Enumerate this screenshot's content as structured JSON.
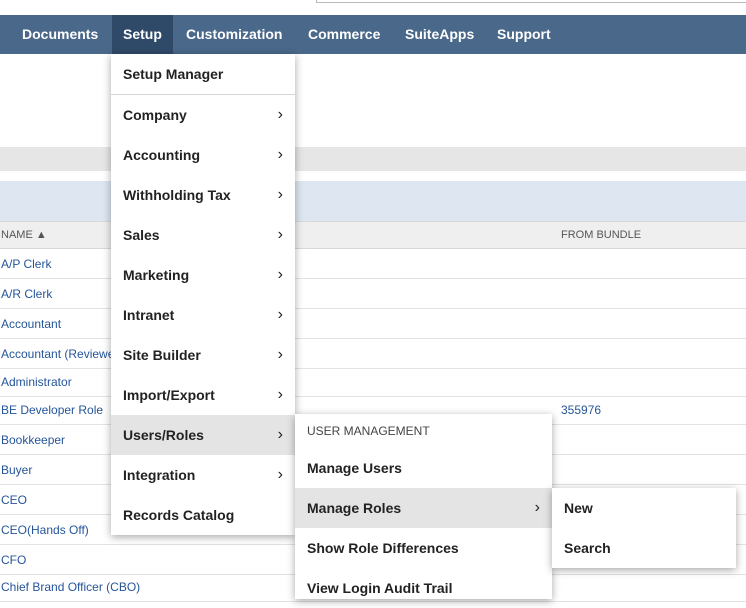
{
  "nav": {
    "items": [
      "Documents",
      "Setup",
      "Customization",
      "Commerce",
      "SuiteApps",
      "Support"
    ]
  },
  "table": {
    "col_name": "NAME ▲",
    "col_bundle": "FROM BUNDLE",
    "rows": [
      {
        "name": "A/P Clerk",
        "bundle": ""
      },
      {
        "name": "A/R Clerk",
        "bundle": ""
      },
      {
        "name": "Accountant",
        "bundle": ""
      },
      {
        "name": "Accountant (Reviewer)",
        "bundle": ""
      },
      {
        "name": "Administrator",
        "bundle": ""
      },
      {
        "name": "BE Developer Role",
        "bundle": "355976"
      },
      {
        "name": "Bookkeeper",
        "bundle": ""
      },
      {
        "name": "Buyer",
        "bundle": ""
      },
      {
        "name": "CEO",
        "bundle": ""
      },
      {
        "name": "CEO(Hands Off)",
        "bundle": ""
      },
      {
        "name": "CFO",
        "bundle": ""
      },
      {
        "name": "Chief Brand Officer (CBO)",
        "bundle": ""
      }
    ]
  },
  "setup_menu": {
    "top": "Setup Manager",
    "items": [
      "Company",
      "Accounting",
      "Withholding Tax",
      "Sales",
      "Marketing",
      "Intranet",
      "Site Builder",
      "Import/Export",
      "Users/Roles",
      "Integration",
      "Records Catalog"
    ],
    "chevron": "›"
  },
  "users_menu": {
    "section": "USER MANAGEMENT",
    "items": [
      "Manage Users",
      "Manage Roles",
      "Show Role Differences",
      "View Login Audit Trail"
    ]
  },
  "roles_menu": {
    "items": [
      "New",
      "Search"
    ]
  },
  "colors": {
    "nav": "#4a6889",
    "nav_active": "#2f4a69",
    "link": "#255599",
    "highlight": "#e4e4e4"
  }
}
